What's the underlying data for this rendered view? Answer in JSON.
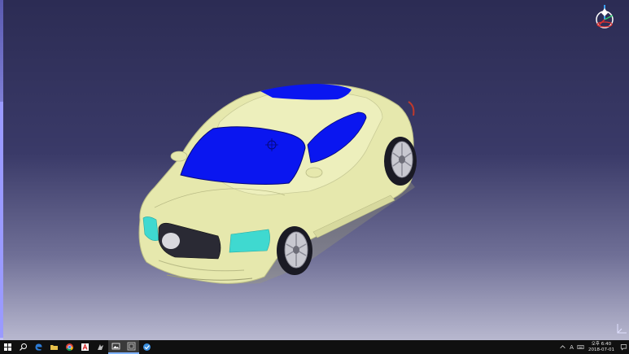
{
  "viewer": {
    "background_top": "#2c2c54",
    "background_bottom": "#b8b8cf",
    "model": {
      "body_color": "#e6e8ad",
      "glass_color": "#0a16f0",
      "light_color": "#3fd9d0",
      "tire_color": "#1a1a24",
      "rim_color": "#c8c8d0"
    },
    "compass_icon": "compass-icon",
    "axis_icon": "axis-icon"
  },
  "taskbar": {
    "items": [
      {
        "name": "start-button",
        "icon": "windows-logo-icon",
        "color": "#ffffff"
      },
      {
        "name": "search-button",
        "icon": "search-icon",
        "color": "#ffffff"
      },
      {
        "name": "edge-button",
        "icon": "edge-icon",
        "color": "#2d7cd6"
      },
      {
        "name": "file-explorer-button",
        "icon": "folder-icon",
        "color": "#e8c04a"
      },
      {
        "name": "chrome-button",
        "icon": "chrome-icon",
        "color": "#db4437"
      },
      {
        "name": "acrobat-button",
        "icon": "acrobat-icon",
        "color": "#d62b2b"
      },
      {
        "name": "app-button",
        "icon": "app-icon",
        "color": "#bbbbbb"
      },
      {
        "name": "photos-button",
        "icon": "photos-icon",
        "color": "#ffffff"
      },
      {
        "name": "catia-button",
        "icon": "catia-icon",
        "color": "#cfcfcf"
      },
      {
        "name": "checkmark-app-button",
        "icon": "checkmark-icon",
        "color": "#3b8fe0"
      }
    ],
    "tray": {
      "clock_time": "오후 6:40",
      "clock_date": "2018-07-01",
      "ime_label": "A"
    }
  }
}
